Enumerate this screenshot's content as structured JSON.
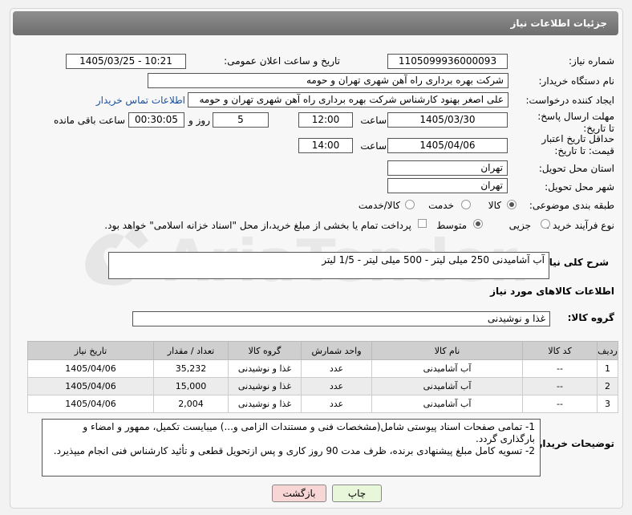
{
  "header": {
    "title": "جزئیات اطلاعات نیاز"
  },
  "fields": {
    "need_number_label": "شماره نیاز:",
    "need_number": "1105099936000093",
    "announce_label": "تاریخ و ساعت اعلان عمومی:",
    "announce_value": "1405/03/25 - 10:21",
    "buyer_org_label": "نام دستگاه خریدار:",
    "buyer_org": "شرکت بهره برداری راه آهن شهری تهران و حومه",
    "creator_label": "ایجاد کننده درخواست:",
    "creator": "علی اصغر بهنود کارشناس شرکت بهره برداری راه آهن شهری تهران و حومه",
    "contact_link": "اطلاعات تماس خریدار",
    "reply_deadline_label": "مهلت ارسال پاسخ: تا تاریخ:",
    "reply_date": "1405/03/30",
    "time_label": "ساعت",
    "reply_time": "12:00",
    "days_value": "5",
    "days_label": "روز و",
    "remaining_value": "00:30:05",
    "remaining_label": "ساعت باقی مانده",
    "price_validity_label": "حداقل تاریخ اعتبار قیمت: تا تاریخ:",
    "price_date": "1405/04/06",
    "price_time": "14:00",
    "province_label": "استان محل تحویل:",
    "province": "تهران",
    "city_label": "شهر محل تحویل:",
    "city": "تهران",
    "category_label": "طبقه بندی موضوعی:",
    "category_options": [
      "کالا",
      "خدمت",
      "کالا/خدمت"
    ],
    "process_label": "نوع فرآیند خرید :",
    "process_options": [
      "جزیی",
      "متوسط"
    ],
    "payment_note": "پرداخت تمام یا بخشی از مبلغ خرید،از محل \"اسناد خزانه اسلامی\" خواهد بود.",
    "description_label": "شرح کلی نیاز:",
    "description": "آب آشامیدنی 250 میلی لیتر - 500 میلی لیتر - 1/5 لیتر",
    "goods_info_label": "اطلاعات کالاهای مورد نیاز",
    "goods_group_label": "گروه کالا:",
    "goods_group": "غذا و نوشیدنی",
    "buyer_notes_label": "توضیحات خریدار:",
    "buyer_notes": [
      "1- تمامی صفحات اسناد پیوستی شامل(مشخصات فنی و مستندات الزامی و...) میبایست تکمیل، ممهور و امضاء و بارگذاری گردد.",
      "2- تسویه کامل مبلغ پیشنهادی برنده، ظرف مدت 90 روز کاری و پس ازتحویل قطعی و تأئید کارشناس فنی انجام میپذیرد."
    ]
  },
  "table": {
    "headers": [
      "ردیف",
      "کد کالا",
      "نام کالا",
      "واحد شمارش",
      "گروه کالا",
      "تعداد / مقدار",
      "تاریخ نیاز"
    ],
    "rows": [
      [
        "1",
        "--",
        "آب آشامیدنی",
        "عدد",
        "غذا و نوشیدنی",
        "35,232",
        "1405/04/06"
      ],
      [
        "2",
        "--",
        "آب آشامیدنی",
        "عدد",
        "غذا و نوشیدنی",
        "15,000",
        "1405/04/06"
      ],
      [
        "3",
        "--",
        "آب آشامیدنی",
        "عدد",
        "غذا و نوشیدنی",
        "2,004",
        "1405/04/06"
      ]
    ]
  },
  "buttons": {
    "print": "چاپ",
    "back": "بازگشت"
  },
  "watermark": {
    "text": "AriaTender.neT"
  },
  "colors": {
    "header_bg": "#7a7a7a",
    "link": "#1a4f9c",
    "print_btn": "#e8f7d9",
    "back_btn": "#f9d6d6"
  }
}
